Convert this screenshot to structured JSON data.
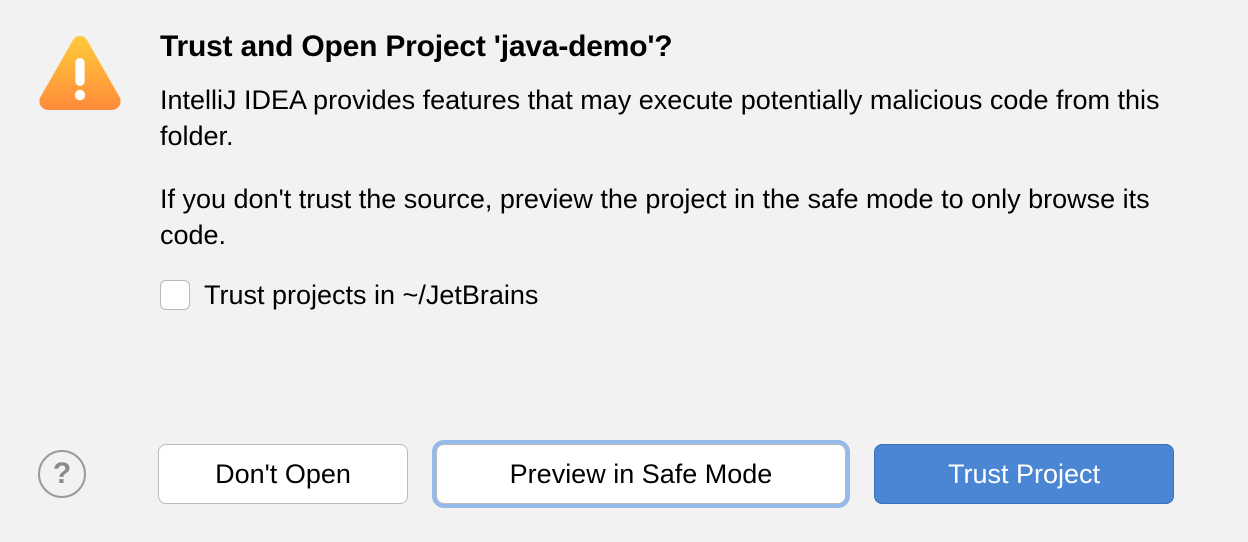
{
  "dialog": {
    "title": "Trust and Open Project 'java-demo'?",
    "body_para1": "IntelliJ IDEA provides features that may execute potentially malicious code from this folder.",
    "body_para2": "If you don't trust the source, preview the project in the safe mode to only browse its code.",
    "checkbox_label": "Trust projects in ~/JetBrains",
    "checkbox_checked": false
  },
  "buttons": {
    "help_glyph": "?",
    "dont_open": "Don't Open",
    "preview_safe_mode": "Preview in Safe Mode",
    "trust_project": "Trust Project"
  },
  "icons": {
    "warning": "warning-triangle"
  }
}
